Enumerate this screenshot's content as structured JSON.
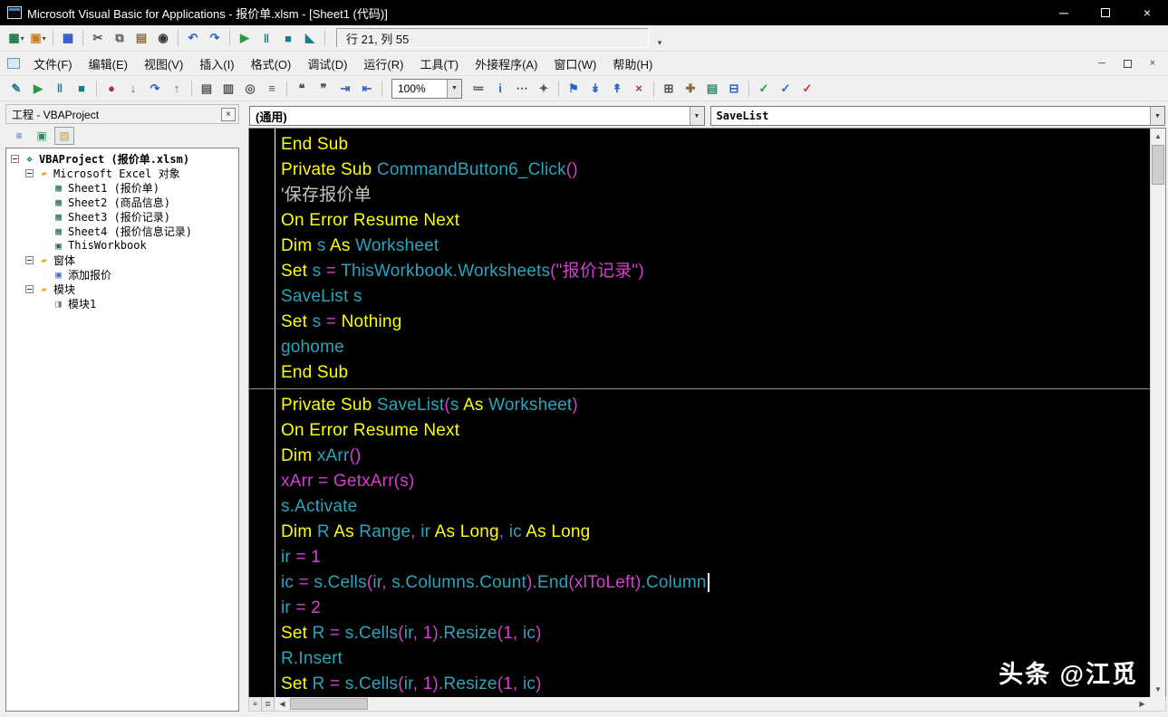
{
  "window": {
    "title": "Microsoft Visual Basic for Applications - 报价单.xlsm - [Sheet1 (代码)]",
    "controls": {
      "minimize": "─",
      "close": "×"
    }
  },
  "toolbar_main": {
    "position_text": "行 21, 列 55",
    "icons": [
      {
        "name": "view-microsoft-excel-button",
        "glyph": "▦",
        "color": "#217346",
        "arrow": true
      },
      {
        "name": "insert-userform-button",
        "glyph": "▣",
        "color": "#c77c2b",
        "arrow": true,
        "sep": true
      },
      {
        "name": "save-button",
        "glyph": "▦",
        "color": "#2b4fc7",
        "sep": true
      },
      {
        "name": "cut-button",
        "glyph": "✂",
        "color": "#555555"
      },
      {
        "name": "copy-button",
        "glyph": "⧉",
        "color": "#555555"
      },
      {
        "name": "paste-button",
        "glyph": "▤",
        "color": "#8a6b3f"
      },
      {
        "name": "find-button",
        "glyph": "◉",
        "color": "#333333",
        "sep": true
      },
      {
        "name": "undo-button",
        "glyph": "↶",
        "color": "#2b62c7"
      },
      {
        "name": "redo-button",
        "glyph": "↷",
        "color": "#2b62c7",
        "sep": true
      },
      {
        "name": "run-button",
        "glyph": "▶",
        "color": "#1e9e3e"
      },
      {
        "name": "break-button",
        "glyph": "‖",
        "color": "#177b8a"
      },
      {
        "name": "reset-button",
        "glyph": "■",
        "color": "#177b8a"
      },
      {
        "name": "design-mode-button",
        "glyph": "◣",
        "color": "#177b8a",
        "sep": true
      }
    ],
    "overflow_icon": "▾"
  },
  "menubar": {
    "items": [
      "文件(F)",
      "编辑(E)",
      "视图(V)",
      "插入(I)",
      "格式(O)",
      "调试(D)",
      "运行(R)",
      "工具(T)",
      "外接程序(A)",
      "窗口(W)",
      "帮助(H)"
    ],
    "mdi_controls": {
      "minimize": "─",
      "close": "×"
    }
  },
  "toolbar_edit": {
    "zoom_value": "100%",
    "icons_before": [
      {
        "name": "design-mode-button-2",
        "glyph": "✎",
        "color": "#177b8a"
      },
      {
        "name": "run-button-2",
        "glyph": "▶",
        "color": "#1e9e3e"
      },
      {
        "name": "break-button-2",
        "glyph": "‖",
        "color": "#177b8a"
      },
      {
        "name": "reset-button-2",
        "glyph": "■",
        "color": "#177b8a",
        "sep": true
      },
      {
        "name": "toggle-breakpoint-button",
        "glyph": "●",
        "color": "#aa3333"
      },
      {
        "name": "step-into-button",
        "glyph": "↓",
        "color": "#2b62c7"
      },
      {
        "name": "step-over-button",
        "glyph": "↷",
        "color": "#2b62c7"
      },
      {
        "name": "step-out-button",
        "glyph": "↑",
        "color": "#2b62c7",
        "sep": true
      },
      {
        "name": "locals-window-button",
        "glyph": "▤",
        "color": "#555555"
      },
      {
        "name": "immediate-window-button",
        "glyph": "▥",
        "color": "#555555"
      },
      {
        "name": "watch-window-button",
        "glyph": "◎",
        "color": "#555555"
      },
      {
        "name": "call-stack-button",
        "glyph": "≡",
        "color": "#555555",
        "sep": true
      },
      {
        "name": "comment-block-button",
        "glyph": "❝",
        "color": "#555555"
      },
      {
        "name": "uncomment-block-button",
        "glyph": "❞",
        "color": "#555555"
      },
      {
        "name": "indent-button",
        "glyph": "⇥",
        "color": "#2b62c7"
      },
      {
        "name": "outdent-button",
        "glyph": "⇤",
        "color": "#2b62c7",
        "sep": true
      }
    ],
    "icons_after": [
      {
        "name": "list-properties-button",
        "glyph": "≔",
        "color": "#555555"
      },
      {
        "name": "quick-info-button",
        "glyph": "i",
        "color": "#2b62c7"
      },
      {
        "name": "parameter-info-button",
        "glyph": "⋯",
        "color": "#555555"
      },
      {
        "name": "complete-word-button",
        "glyph": "✦",
        "color": "#555555",
        "sep": true
      },
      {
        "name": "toggle-bookmark-button",
        "glyph": "⚑",
        "color": "#2b62c7"
      },
      {
        "name": "next-bookmark-button",
        "glyph": "↡",
        "color": "#2b62c7"
      },
      {
        "name": "previous-bookmark-button",
        "glyph": "↟",
        "color": "#2b62c7"
      },
      {
        "name": "clear-bookmarks-button",
        "glyph": "×",
        "color": "#aa3333",
        "sep": true
      },
      {
        "name": "object-browser-button",
        "glyph": "⊞",
        "color": "#555555"
      },
      {
        "name": "toolbox-button",
        "glyph": "✚",
        "color": "#8a6b3f"
      },
      {
        "name": "properties-window-button",
        "glyph": "▤",
        "color": "#2b8f5f"
      },
      {
        "name": "project-explorer-button",
        "glyph": "⊟",
        "color": "#2b62c7",
        "sep": true
      },
      {
        "name": "format-check-green-button",
        "glyph": "✓",
        "color": "#1e9e3e"
      },
      {
        "name": "format-check-blue-button",
        "glyph": "✓",
        "color": "#2b62c7"
      },
      {
        "name": "format-check-red-button",
        "glyph": "✓",
        "color": "#cc3333"
      }
    ]
  },
  "project_panel": {
    "title": "工程 - VBAProject",
    "toolbar": [
      {
        "name": "view-code-button",
        "glyph": "≡",
        "color": "#2b62c7"
      },
      {
        "name": "view-object-button",
        "glyph": "▣",
        "color": "#2b8f5f"
      },
      {
        "name": "toggle-folders-button",
        "glyph": "▨",
        "color": "#c7a02b",
        "pressed": true
      }
    ],
    "tree": [
      {
        "label": "VBAProject (报价单.xlsm)",
        "level": 0,
        "expander": true,
        "icon": "project-icon",
        "glyph": "❖",
        "color": "#177b8a",
        "bold": true
      },
      {
        "label": "Microsoft Excel 对象",
        "level": 1,
        "expander": true,
        "icon": "folder-icon",
        "glyph": "▰",
        "color": "#e0b23a"
      },
      {
        "label": "Sheet1 (报价单)",
        "level": 2,
        "icon": "worksheet-icon",
        "glyph": "▦",
        "color": "#1e7145"
      },
      {
        "label": "Sheet2 (商品信息)",
        "level": 2,
        "icon": "worksheet-icon",
        "glyph": "▦",
        "color": "#1e7145"
      },
      {
        "label": "Sheet3 (报价记录)",
        "level": 2,
        "icon": "worksheet-icon",
        "glyph": "▦",
        "color": "#1e7145"
      },
      {
        "label": "Sheet4 (报价信息记录)",
        "level": 2,
        "icon": "worksheet-icon",
        "glyph": "▦",
        "color": "#1e7145"
      },
      {
        "label": "ThisWorkbook",
        "level": 2,
        "icon": "workbook-icon",
        "glyph": "▣",
        "color": "#1e7145"
      },
      {
        "label": "窗体",
        "level": 1,
        "expander": true,
        "icon": "folder-icon",
        "glyph": "▰",
        "color": "#e0b23a"
      },
      {
        "label": "添加报价",
        "level": 2,
        "icon": "userform-icon",
        "glyph": "▣",
        "color": "#3b6fd4"
      },
      {
        "label": "模块",
        "level": 1,
        "expander": true,
        "icon": "folder-icon",
        "glyph": "▰",
        "color": "#e0b23a"
      },
      {
        "label": "模块1",
        "level": 2,
        "icon": "module-icon",
        "glyph": "◨",
        "color": "#777777"
      }
    ]
  },
  "code_pane": {
    "object_dropdown": "(通用)",
    "procedure_dropdown": "SaveList",
    "lines": [
      {
        "tokens": [
          [
            "y",
            "End Sub"
          ]
        ]
      },
      {
        "tokens": [
          [
            "y",
            "Private Sub "
          ],
          [
            "c",
            "CommandButton6_Click"
          ],
          [
            "m",
            "()"
          ]
        ]
      },
      {
        "tokens": [
          [
            "g",
            "'保存报价单"
          ]
        ]
      },
      {
        "tokens": [
          [
            "y",
            "On Error Resume Next"
          ]
        ]
      },
      {
        "tokens": [
          [
            "y",
            "Dim "
          ],
          [
            "c",
            "s "
          ],
          [
            "y",
            "As "
          ],
          [
            "c",
            "Worksheet"
          ]
        ]
      },
      {
        "tokens": [
          [
            "y",
            "Set "
          ],
          [
            "c",
            "s "
          ],
          [
            "m",
            "= "
          ],
          [
            "c",
            "ThisWorkbook.Worksheets"
          ],
          [
            "m",
            "(\"报价记录\")"
          ]
        ]
      },
      {
        "tokens": [
          [
            "c",
            "SaveList s"
          ]
        ]
      },
      {
        "tokens": [
          [
            "y",
            "Set "
          ],
          [
            "c",
            "s "
          ],
          [
            "m",
            "= "
          ],
          [
            "y",
            "Nothing"
          ]
        ]
      },
      {
        "tokens": [
          [
            "c",
            "gohome"
          ]
        ]
      },
      {
        "tokens": [
          [
            "y",
            "End Sub"
          ]
        ],
        "sep_after": true
      },
      {
        "tokens": [
          [
            "y",
            "Private Sub "
          ],
          [
            "c",
            "SaveList"
          ],
          [
            "m",
            "("
          ],
          [
            "c",
            "s "
          ],
          [
            "y",
            "As "
          ],
          [
            "c",
            "Worksheet"
          ],
          [
            "m",
            ")"
          ]
        ]
      },
      {
        "tokens": [
          [
            "y",
            "On Error Resume Next"
          ]
        ]
      },
      {
        "tokens": [
          [
            "y",
            "Dim "
          ],
          [
            "c",
            "xArr"
          ],
          [
            "m",
            "()"
          ]
        ]
      },
      {
        "tokens": [
          [
            "m",
            "xArr = GetxArr(s)"
          ]
        ]
      },
      {
        "tokens": [
          [
            "c",
            "s.Activate"
          ]
        ]
      },
      {
        "tokens": [
          [
            "y",
            "Dim "
          ],
          [
            "c",
            "R "
          ],
          [
            "y",
            "As "
          ],
          [
            "c",
            "Range"
          ],
          [
            "m",
            ", "
          ],
          [
            "c",
            "ir "
          ],
          [
            "y",
            "As Long"
          ],
          [
            "m",
            ", "
          ],
          [
            "c",
            "ic "
          ],
          [
            "y",
            "As Long"
          ]
        ]
      },
      {
        "tokens": [
          [
            "c",
            "ir "
          ],
          [
            "m",
            "= 1"
          ]
        ]
      },
      {
        "tokens": [
          [
            "c",
            "ic "
          ],
          [
            "m",
            "= "
          ],
          [
            "c",
            "s.Cells"
          ],
          [
            "m",
            "("
          ],
          [
            "c",
            "ir"
          ],
          [
            "m",
            ", "
          ],
          [
            "c",
            "s.Columns.Count"
          ],
          [
            "m",
            ")"
          ],
          [
            "c",
            ".End"
          ],
          [
            "m",
            "(xlToLeft)"
          ],
          [
            "c",
            ".Column"
          ]
        ],
        "caret": true
      },
      {
        "tokens": [
          [
            "c",
            "ir "
          ],
          [
            "m",
            "= 2"
          ]
        ]
      },
      {
        "tokens": [
          [
            "y",
            "Set "
          ],
          [
            "c",
            "R "
          ],
          [
            "m",
            "= "
          ],
          [
            "c",
            "s.Cells"
          ],
          [
            "m",
            "("
          ],
          [
            "c",
            "ir"
          ],
          [
            "m",
            ", 1)"
          ],
          [
            "c",
            ".Resize"
          ],
          [
            "m",
            "(1, "
          ],
          [
            "c",
            "ic"
          ],
          [
            "m",
            ")"
          ]
        ]
      },
      {
        "tokens": [
          [
            "c",
            "R.Insert"
          ]
        ]
      },
      {
        "tokens": [
          [
            "y",
            "Set "
          ],
          [
            "c",
            "R "
          ],
          [
            "m",
            "= "
          ],
          [
            "c",
            "s.Cells"
          ],
          [
            "m",
            "("
          ],
          [
            "c",
            "ir"
          ],
          [
            "m",
            ", 1)"
          ],
          [
            "c",
            ".Resize"
          ],
          [
            "m",
            "(1, "
          ],
          [
            "c",
            "ic"
          ],
          [
            "m",
            ")"
          ]
        ]
      }
    ],
    "colors": {
      "keyword": "#ffff00",
      "identifier": "#2ba4bc",
      "operator_literal": "#d63fce",
      "comment": "#c4c4c4",
      "background": "#000000"
    }
  },
  "watermark": {
    "text": "头条 @江觅"
  }
}
